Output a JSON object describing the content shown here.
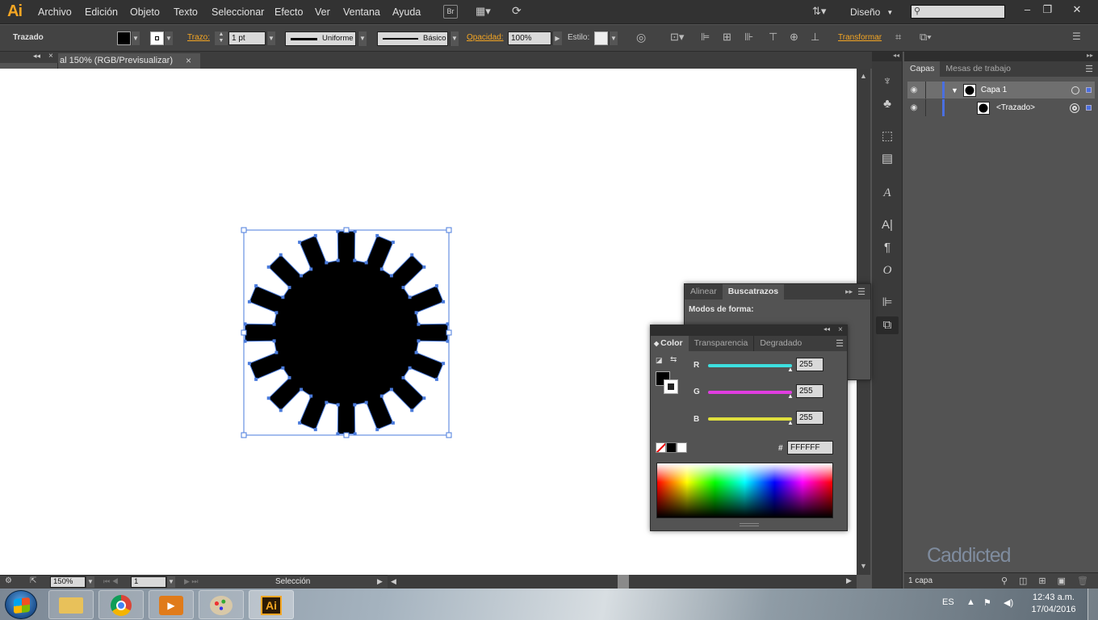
{
  "app": {
    "logo": "Ai"
  },
  "menu": {
    "items": [
      "Archivo",
      "Edición",
      "Objeto",
      "Texto",
      "Seleccionar",
      "Efecto",
      "Ver",
      "Ventana",
      "Ayuda"
    ],
    "bridge": "Br",
    "workspace": "Diseño",
    "search_placeholder": "",
    "min": "–",
    "restore": "❐",
    "close": "✕"
  },
  "control": {
    "selection_label": "Trazado",
    "stroke_label": "Trazo:",
    "stroke_weight": "1 pt",
    "profile_label": "Uniforme",
    "brush_label": "Básico",
    "opacity_label": "Opacidad:",
    "opacity_value": "100%",
    "style_label": "Estilo:",
    "transform_label": "Transformar"
  },
  "document": {
    "tab_title": "al 150% (RGB/Previsualizar)",
    "close": "×"
  },
  "status": {
    "zoom": "150%",
    "artboard": "1",
    "tool_name": "Selección"
  },
  "layers": {
    "tabs": [
      "Capas",
      "Mesas de trabajo"
    ],
    "rows": [
      {
        "name": "Capa 1"
      },
      {
        "name": "<Trazado>"
      }
    ],
    "footer": "1 capa",
    "watermark": "Caddicted"
  },
  "pathfinder": {
    "tabs": [
      "Alinear",
      "Buscatrazos"
    ],
    "modes_label": "Modos de forma:"
  },
  "color_panel": {
    "tabs": [
      "Color",
      "Transparencia",
      "Degradado"
    ],
    "r_label": "R",
    "g_label": "G",
    "b_label": "B",
    "r": "255",
    "g": "255",
    "b": "255",
    "hex_label": "#",
    "hex": "FFFFFF",
    "r_color": "#3de0e0",
    "g_color": "#e03de0",
    "b_color": "#e0e03d"
  },
  "taskbar": {
    "lang": "ES",
    "time": "12:43 a.m.",
    "date": "17/04/2016",
    "ai_label": "Ai"
  },
  "colors": {
    "accent_orange": "#f5a623",
    "selection_blue": "#4a7bdc",
    "layer_blue": "#4a6fe0"
  }
}
